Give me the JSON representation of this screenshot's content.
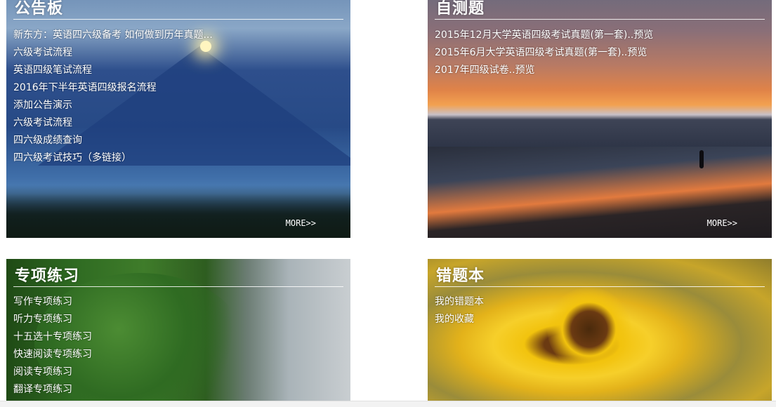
{
  "panels": {
    "notice": {
      "title": "公告板",
      "items": [
        "新东方：英语四六级备考 如何做到历年真题...",
        "六级考试流程",
        "英语四级笔试流程",
        "2016年下半年英语四级报名流程",
        "添加公告演示",
        "六级考试流程",
        "四六级成绩查询",
        "四六级考试技巧（多链接）"
      ],
      "more": "MORE>>"
    },
    "selftest": {
      "title": "自测题",
      "items": [
        "2015年12月大学英语四级考试真题(第一套)..预览",
        "2015年6月大学英语四级考试真题(第一套)..预览",
        "2017年四级试卷..预览"
      ],
      "more": "MORE>>"
    },
    "practice": {
      "title": "专项练习",
      "items": [
        "写作专项练习",
        "听力专项练习",
        "十五选十专项练习",
        "快速阅读专项练习",
        "阅读专项练习",
        "翻译专项练习"
      ]
    },
    "wrongbook": {
      "title": "错题本",
      "items": [
        "我的错题本",
        "我的收藏"
      ]
    }
  }
}
